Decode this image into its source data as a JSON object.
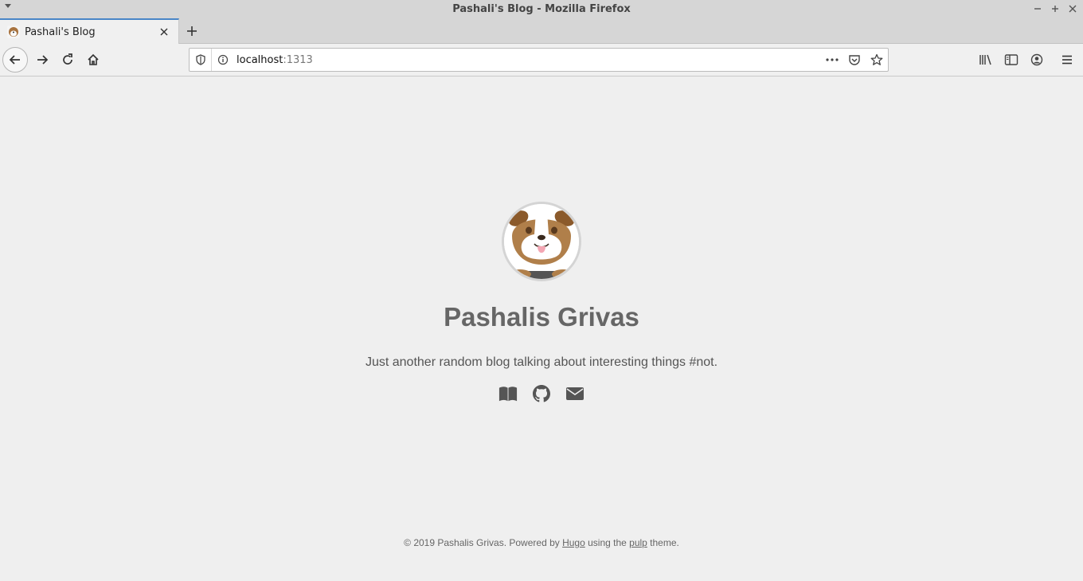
{
  "window": {
    "title": "Pashali's Blog - Mozilla Firefox"
  },
  "tab": {
    "label": "Pashali's Blog"
  },
  "urlbar": {
    "host": "localhost",
    "port": ":1313"
  },
  "page": {
    "title": "Pashalis Grivas",
    "description": "Just another random blog talking about interesting things #not.",
    "social": [
      "book-icon",
      "github-icon",
      "envelope-icon"
    ],
    "footer": {
      "prefix": "© 2019 Pashalis Grivas. Powered by ",
      "hugo_link": "Hugo",
      "middle": " using the ",
      "theme_link": "pulp",
      "suffix": " theme."
    }
  }
}
